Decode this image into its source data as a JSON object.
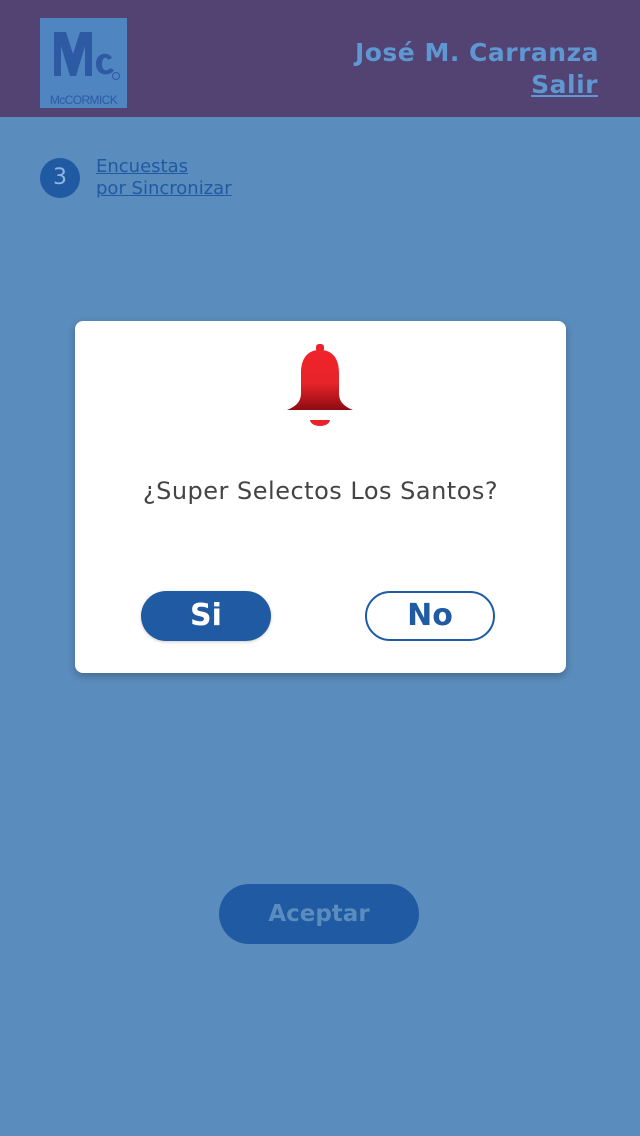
{
  "header": {
    "brand": "McCORMICK",
    "user_name": "José M. Carranza",
    "logout_label": "Salir"
  },
  "sync": {
    "count": "3",
    "label_line1": "Encuestas",
    "label_line2": "por Sincronizar"
  },
  "dialog": {
    "icon": "bell-icon",
    "question": "¿Super Selectos Los Santos?",
    "yes_label": "Si",
    "no_label": "No"
  },
  "footer": {
    "accept_label": "Aceptar"
  },
  "colors": {
    "header_bg": "#524373",
    "page_bg": "#5a8cbd",
    "primary": "#1f5aa3",
    "alert_red": "#e8232a"
  }
}
